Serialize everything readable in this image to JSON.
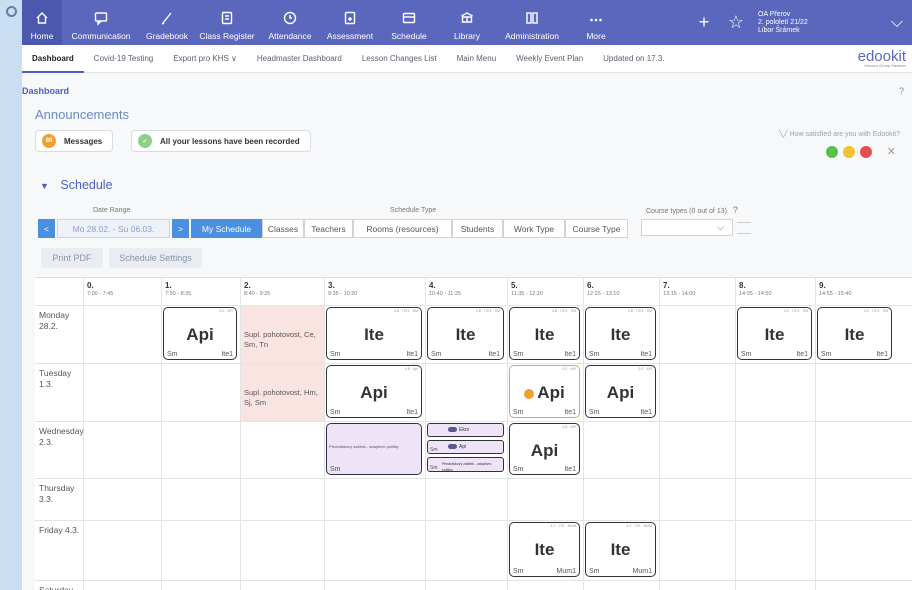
{
  "nav": {
    "items": [
      {
        "label": "Home",
        "icon": "home-icon"
      },
      {
        "label": "Communication",
        "icon": "chat-icon"
      },
      {
        "label": "Gradebook",
        "icon": "pen-icon"
      },
      {
        "label": "Class Register",
        "icon": "register-icon"
      },
      {
        "label": "Attendance",
        "icon": "clock-icon"
      },
      {
        "label": "Assessment",
        "icon": "assessment-icon"
      },
      {
        "label": "Schedule",
        "icon": "schedule-icon"
      },
      {
        "label": "Library",
        "icon": "library-icon"
      },
      {
        "label": "Administration",
        "icon": "admin-icon"
      },
      {
        "label": "More",
        "icon": "more-icon"
      }
    ],
    "user_line1": "OA Přerov",
    "user_line2": "2. pololetí 21/22",
    "user_line3": "Libor Šrámek"
  },
  "subnav": {
    "items": [
      "Dashboard",
      "Covid-19 Testing",
      "Export pro KHS ∨",
      "Headmaster Dashboard",
      "Lesson Changes List",
      "Main Menu",
      "Weekly Event Plan",
      "Updated on 17.3."
    ],
    "brand": "edookit",
    "brand_sub": "Unicorn Group Member"
  },
  "breadcrumb": "Dashboard",
  "help": "?",
  "announcements": {
    "title": "Announcements",
    "messages_count": "80",
    "messages_label": "Messages",
    "lessons_label": "All your lessons have been recorded",
    "satisfied": "╲╱ How satisfied are you with Edookit?",
    "close": "✕"
  },
  "schedule": {
    "title": "Schedule",
    "date_range_label": "Date Range",
    "date_range": "Mo 28.02. - Su 06.03.",
    "prev": "<",
    "next": ">",
    "type_label": "Schedule Type",
    "types": [
      "My Schedule",
      "Classes",
      "Teachers",
      "Rooms (resources)",
      "Students",
      "Work Type",
      "Course Type"
    ],
    "course_types_label": "Course types (0 out of 13)",
    "course_types_help": "?",
    "print_pdf": "Print PDF",
    "settings": "Schedule Settings"
  },
  "periods": [
    {
      "n": "0.",
      "t": "7:00 - 7:45"
    },
    {
      "n": "1.",
      "t": "7:50 - 8:35"
    },
    {
      "n": "2.",
      "t": "8:40 - 9:25"
    },
    {
      "n": "3.",
      "t": "9:35 - 10:20"
    },
    {
      "n": "4.",
      "t": "10:40 - 11:25"
    },
    {
      "n": "5.",
      "t": "11:35 - 12:20"
    },
    {
      "n": "6.",
      "t": "12:25 - 13:10"
    },
    {
      "n": "7.",
      "t": "13:15 - 14:00"
    },
    {
      "n": "8.",
      "t": "14:05 - 14:50"
    },
    {
      "n": "9.",
      "t": "14:55 - 15:40"
    }
  ],
  "days": [
    {
      "l1": "Monday",
      "l2": "28.2."
    },
    {
      "l1": "Tuesday",
      "l2": "1.3."
    },
    {
      "l1": "Wednesday",
      "l2": "2.3."
    },
    {
      "l1": "Thursday",
      "l2": "3.3."
    },
    {
      "l1": "Friday 4.3.",
      "l2": ""
    },
    {
      "l1": "Saturday",
      "l2": ""
    }
  ],
  "lessons": [
    {
      "day": 0,
      "p": 1,
      "subj": "Api",
      "left": "Sm",
      "right": "Ite1",
      "cap": "2.E · API"
    },
    {
      "day": 0,
      "p": 3,
      "subj": "Ite",
      "left": "Sm",
      "right": "Ite1",
      "cap": "4.B · ITE1 · SM"
    },
    {
      "day": 0,
      "p": 4,
      "subj": "Ite",
      "left": "Sm",
      "right": "Ite1",
      "cap": "4.B · ITE1 · SM"
    },
    {
      "day": 0,
      "p": 5,
      "subj": "Ite",
      "left": "Sm",
      "right": "Ite1",
      "cap": "4.B · ITE1 · SM"
    },
    {
      "day": 0,
      "p": 6,
      "subj": "Ite",
      "left": "Sm",
      "right": "Ite1",
      "cap": "4.B · ITE1 · SM"
    },
    {
      "day": 0,
      "p": 8,
      "subj": "Ite",
      "left": "Sm",
      "right": "Ite1",
      "cap": "4.C · ITE1 · SM"
    },
    {
      "day": 0,
      "p": 9,
      "subj": "Ite",
      "left": "Sm",
      "right": "Ite1",
      "cap": "4.C · ITE1 · SM"
    },
    {
      "day": 1,
      "p": 3,
      "subj": "Api",
      "left": "Sm",
      "right": "Ite1",
      "cap": "4.B · Api"
    },
    {
      "day": 1,
      "p": 5,
      "subj": "Api",
      "left": "Sm",
      "right": "Ite1",
      "cap": "2.E · API",
      "orange": true
    },
    {
      "day": 1,
      "p": 6,
      "subj": "Api",
      "left": "Sm",
      "right": "Ite1",
      "cap": "2.E · API"
    },
    {
      "day": 2,
      "p": 5,
      "subj": "Api",
      "left": "Sm",
      "right": "Ite1",
      "cap": "4.B · API"
    },
    {
      "day": 4,
      "p": 5,
      "subj": "Ite",
      "left": "Sm",
      "right": "Mum1",
      "cap": "4.C · ITE · MUM"
    },
    {
      "day": 4,
      "p": 6,
      "subj": "Ite",
      "left": "Sm",
      "right": "Mum1",
      "cap": "4.C · ITE · MUM"
    }
  ],
  "substitutions": [
    {
      "day": 0,
      "text": "Supl. pohotovost, Ce, Sm, Tn"
    },
    {
      "day": 1,
      "text": "Supl. pohotovost, Hm, Sj, Sm"
    }
  ],
  "event_wed3": {
    "text": "Přednáškový zážitek - adaptivní politiky",
    "left": "Sm"
  },
  "minis_wed4": [
    {
      "label": "Ekro",
      "left": ""
    },
    {
      "label": "Api",
      "left": "Sm"
    },
    {
      "label": "Přednáškový zážitek - adaptivní politiky",
      "left": "Sm"
    }
  ],
  "colors": {
    "nav": "#5b67bd",
    "accent": "#4a8fe0",
    "orange": "#f0a030",
    "subst": "#f9e4e2",
    "event": "#efe4f7"
  }
}
